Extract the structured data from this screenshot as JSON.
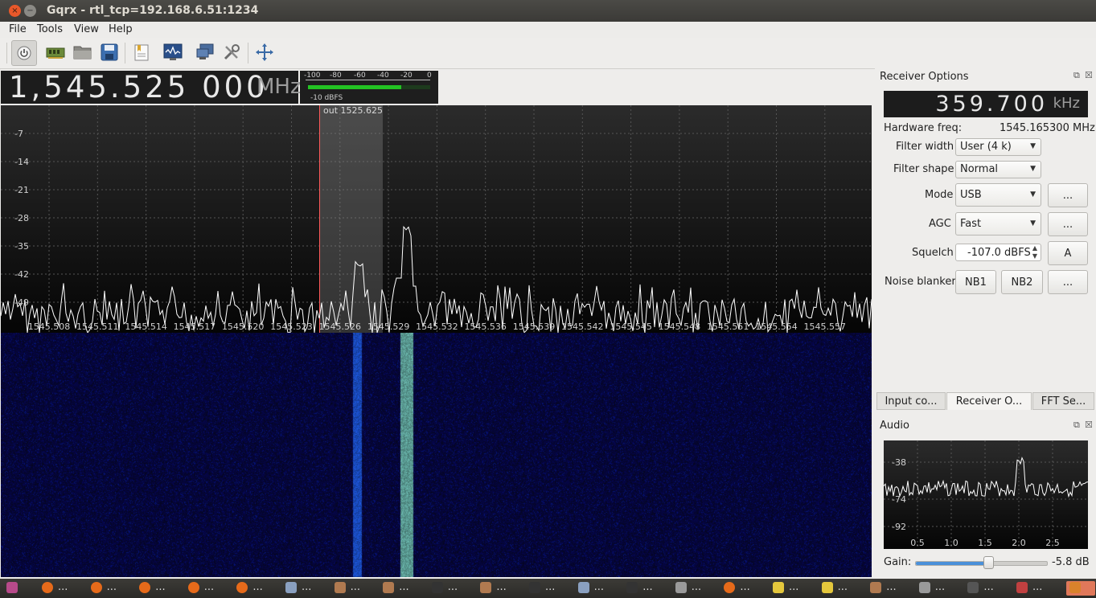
{
  "window": {
    "title": "Gqrx  - rtl_tcp=192.168.6.51:1234",
    "close": "×",
    "minimize": "−"
  },
  "menu": [
    "File",
    "Tools",
    "View",
    "Help"
  ],
  "toolbar": {
    "icons": [
      "power-icon",
      "device-icon",
      "open-icon",
      "save-icon",
      "bookmark-icon",
      "spectrum-icon",
      "network-icon",
      "settings-icon",
      "fullscreen-icon"
    ]
  },
  "frequency": {
    "value": "1,545.525 000",
    "unit": "MHz"
  },
  "meter": {
    "scale": [
      "-100",
      "-80",
      "-60",
      "-40",
      "-20",
      "0"
    ],
    "level": "-10 dBFS",
    "fill": 0.76
  },
  "plot": {
    "filter_label": "out 1525.625",
    "y_ticks": [
      "-7",
      "-14",
      "-21",
      "-28",
      "-35",
      "-42",
      "-49"
    ],
    "x_ticks": [
      "1545.508",
      "1545.511",
      "1545.514",
      "1545.517",
      "1545.520",
      "1545.523",
      "1545.526",
      "1545.529",
      "1545.532",
      "1545.536",
      "1545.539",
      "1545.542",
      "1545.545",
      "1545.548",
      "1545.551",
      "1545.554",
      "1545.557"
    ]
  },
  "receiver": {
    "title": "Receiver Options",
    "freq": "359.700",
    "freq_unit": "kHz",
    "hw_label": "Hardware freq:",
    "hw_value": "1545.165300 MHz",
    "filter_width_label": "Filter width",
    "filter_width": "User (4 k)",
    "filter_shape_label": "Filter shape",
    "filter_shape": "Normal",
    "mode_label": "Mode",
    "mode": "USB",
    "agc_label": "AGC",
    "agc": "Fast",
    "squelch_label": "Squelch",
    "squelch": "-107.0 dBFS",
    "squelch_auto": "A",
    "nb_label": "Noise blanker",
    "nb1": "NB1",
    "nb2": "NB2",
    "more": "..."
  },
  "tabs": [
    "Input co...",
    "Receiver O...",
    "FFT Se..."
  ],
  "audio": {
    "title": "Audio",
    "y_ticks": [
      "-38",
      "-74",
      "-92"
    ],
    "x_ticks": [
      "0.5",
      "1.0",
      "1.5",
      "2.0",
      "2.5"
    ],
    "gain_label": "Gain:",
    "gain_value": "-5.8 dB",
    "gain_level": 0.56
  },
  "taskbar": {
    "label": "...",
    "items": [
      "firefox",
      "firefox",
      "firefox",
      "firefox",
      "firefox",
      "network",
      "files",
      "files",
      "terminal",
      "files",
      "terminal",
      "network",
      "terminal",
      "editor",
      "firefox",
      "notes",
      "notes",
      "files",
      "editor",
      "monitor",
      "tool",
      "gqrx"
    ]
  }
}
